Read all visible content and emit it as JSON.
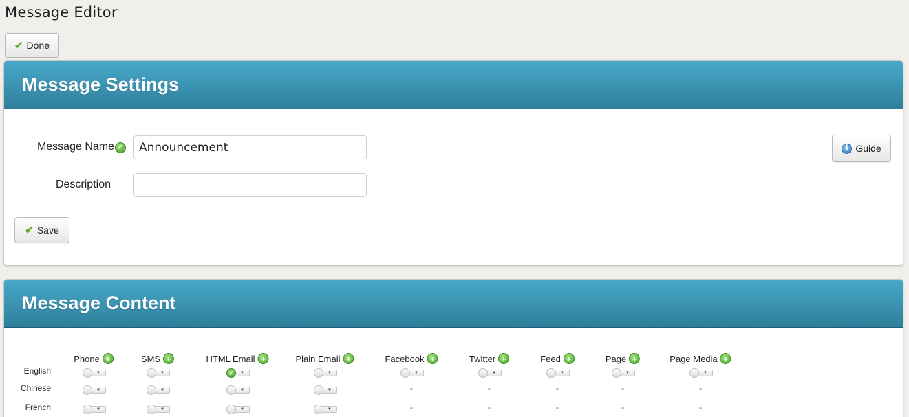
{
  "page_title": "Message Editor",
  "toolbar": {
    "done_label": "Done"
  },
  "settings": {
    "title": "Message Settings",
    "name_label": "Message Name",
    "name_value": "Announcement",
    "description_label": "Description",
    "description_value": "",
    "guide_label": "Guide",
    "save_label": "Save"
  },
  "content": {
    "title": "Message Content",
    "columns": [
      "Phone",
      "SMS",
      "HTML Email",
      "Plain Email",
      "Facebook",
      "Twitter",
      "Feed",
      "Page",
      "Page Media"
    ],
    "rows": [
      {
        "language": "English",
        "cells": [
          "off",
          "off",
          "on",
          "off",
          "off",
          "off",
          "off",
          "off",
          "off"
        ]
      },
      {
        "language": "Chinese",
        "cells": [
          "off",
          "off",
          "off",
          "off",
          "-",
          "-",
          "-",
          "-",
          "-"
        ]
      },
      {
        "language": "French",
        "cells": [
          "off",
          "off",
          "off",
          "off",
          "-",
          "-",
          "-",
          "-",
          "-"
        ]
      }
    ]
  },
  "icons": {
    "done": "check-icon",
    "valid": "ok-circle-icon",
    "guide": "info-icon",
    "save": "check-icon",
    "add": "plus-circle-icon",
    "toggle": "toggle-dropdown-icon"
  },
  "colors": {
    "header_top": "#48a9c8",
    "header_bottom": "#2f7f9c",
    "accent_green": "#47a326",
    "background": "#f1efeb"
  }
}
